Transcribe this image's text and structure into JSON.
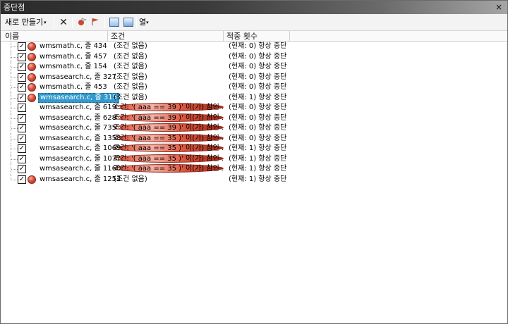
{
  "window": {
    "title": "중단점",
    "close_label": "×"
  },
  "toolbar": {
    "new_label": "새로 만들기",
    "new_arrow": "▾",
    "delete_icon": "✕",
    "columns_label": "열",
    "columns_arrow": "▾"
  },
  "columns": {
    "name": "이름",
    "condition": "조건",
    "hit_count": "적중 횟수"
  },
  "rows": [
    {
      "name": "wmsmath.c, 줄 434",
      "condition": "(조건 없음)",
      "hit": "(현재: 0) 항상 중단",
      "checked": true,
      "conditional": false,
      "selected": false
    },
    {
      "name": "wmsmath.c, 줄 457",
      "condition": "(조건 없음)",
      "hit": "(현재: 0) 항상 중단",
      "checked": true,
      "conditional": false,
      "selected": false
    },
    {
      "name": "wmsmath.c, 줄 154",
      "condition": "(조건 없음)",
      "hit": "(현재: 0) 항상 중단",
      "checked": true,
      "conditional": false,
      "selected": false
    },
    {
      "name": "wmsasearch.c, 줄 327",
      "condition": "(조건 없음)",
      "hit": "(현재: 0) 항상 중단",
      "checked": true,
      "conditional": false,
      "selected": false
    },
    {
      "name": "wmsmath.c, 줄 453",
      "condition": "(조건 없음)",
      "hit": "(현재: 0) 항상 중단",
      "checked": true,
      "conditional": false,
      "selected": false
    },
    {
      "name": "wmsasearch.c, 줄 315",
      "condition": "(조건 없음)",
      "hit": "(현재: 1) 항상 중단",
      "checked": true,
      "conditional": false,
      "selected": true
    },
    {
      "name": "wmsasearch.c, 줄 619",
      "condition": "조건: '( aaa == 39 )' 이(가) 참인 ...",
      "hit": "(현재: 0) 항상 중단",
      "checked": true,
      "conditional": true,
      "selected": false
    },
    {
      "name": "wmsasearch.c, 줄 628",
      "condition": "조건: '( aaa == 39 )' 이(가) 참인 ...",
      "hit": "(현재: 0) 항상 중단",
      "checked": true,
      "conditional": true,
      "selected": false
    },
    {
      "name": "wmsasearch.c, 줄 735",
      "condition": "조건: '( aaa == 39 )' 이(가) 참인 ...",
      "hit": "(현재: 0) 항상 중단",
      "checked": true,
      "conditional": true,
      "selected": false
    },
    {
      "name": "wmsasearch.c, 줄 1358",
      "condition": "조건: '( aaa == 35 )' 이(가) 참인 ...",
      "hit": "(현재: 0) 항상 중단",
      "checked": true,
      "conditional": true,
      "selected": false
    },
    {
      "name": "wmsasearch.c, 줄 1069",
      "condition": "조건: '( aaa == 35 )' 이(가) 참인 ...",
      "hit": "(현재: 1) 항상 중단",
      "checked": true,
      "conditional": true,
      "selected": false
    },
    {
      "name": "wmsasearch.c, 줄 1077",
      "condition": "조건: '( aaa == 35 )' 이(가) 참인 ...",
      "hit": "(현재: 1) 항상 중단",
      "checked": true,
      "conditional": true,
      "selected": false
    },
    {
      "name": "wmsasearch.c, 줄 1160",
      "condition": "조건: '( aaa == 35 )' 이(가) 참인 ...",
      "hit": "(현재: 1) 항상 중단",
      "checked": true,
      "conditional": true,
      "selected": false
    },
    {
      "name": "wmsasearch.c, 줄 1252",
      "condition": "(조건 없음)",
      "hit": "(현재: 1) 항상 중단",
      "checked": true,
      "conditional": false,
      "selected": false
    }
  ]
}
